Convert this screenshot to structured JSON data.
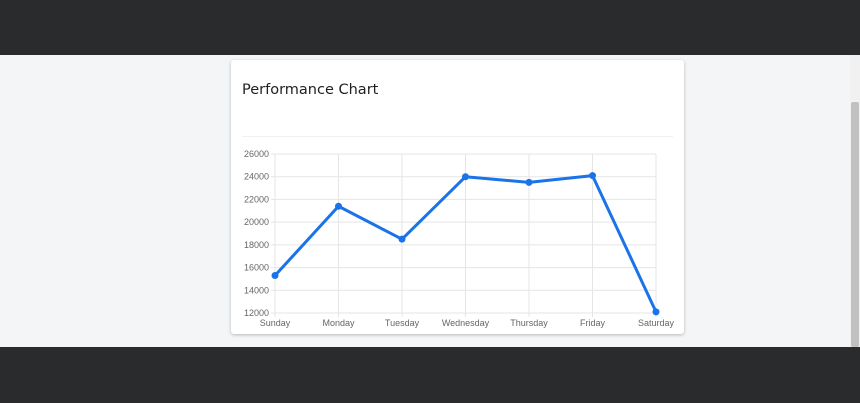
{
  "card": {
    "title": "Performance Chart"
  },
  "colors": {
    "line": "#1a73e8",
    "grid": "#e5e5e5",
    "page_bg": "#f4f5f7",
    "chrome": "#2a2b2d"
  },
  "chart_data": {
    "type": "line",
    "categories": [
      "Sunday",
      "Monday",
      "Tuesday",
      "Wednesday",
      "Thursday",
      "Friday",
      "Saturday"
    ],
    "series": [
      {
        "values": [
          15300,
          21400,
          18500,
          24000,
          23500,
          24100,
          12100
        ]
      }
    ],
    "ylim": [
      12000,
      26000
    ],
    "yticks": [
      "12000",
      "14000",
      "16000",
      "18000",
      "20000",
      "22000",
      "24000",
      "26000"
    ],
    "grid": true,
    "legend": "none"
  }
}
